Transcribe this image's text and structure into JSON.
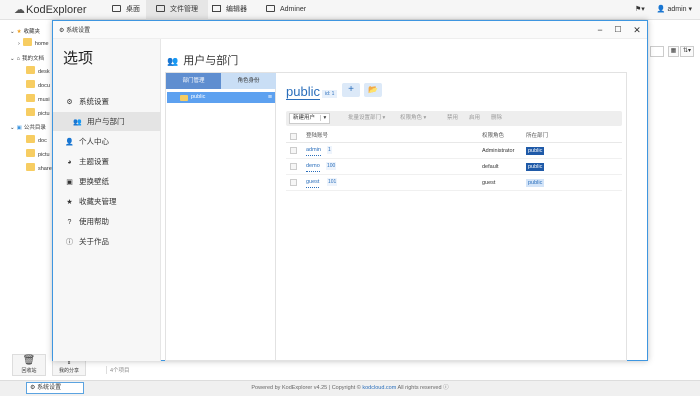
{
  "app": {
    "logo": "KodExplorer",
    "nav_tabs": [
      {
        "label": "桌面",
        "icon": "desktop-icon"
      },
      {
        "label": "文件管理",
        "icon": "folder-manage-icon"
      },
      {
        "label": "编辑器",
        "icon": "edit-icon"
      },
      {
        "label": "Adminer",
        "icon": "database-icon"
      }
    ],
    "user": "admin",
    "flag_icon": "flag-icon"
  },
  "background": {
    "tree": [
      {
        "label": "收藏夹",
        "kind": "star"
      },
      {
        "label": "home",
        "kind": "folder"
      },
      {
        "label": "我的文档",
        "kind": "home"
      },
      {
        "label": "desk",
        "kind": "folder"
      },
      {
        "label": "docu",
        "kind": "folder"
      },
      {
        "label": "musi",
        "kind": "folder"
      },
      {
        "label": "pictu",
        "kind": "folder"
      },
      {
        "label": "公共目录",
        "kind": "share"
      },
      {
        "label": "doc",
        "kind": "folder"
      },
      {
        "label": "pictu",
        "kind": "folder"
      },
      {
        "label": "share",
        "kind": "folder"
      }
    ],
    "bottom_icons": [
      {
        "label": "回收站",
        "icon": "trash-icon"
      },
      {
        "label": "我的分享",
        "icon": "share-icon"
      }
    ],
    "item_count": "4个项目",
    "footer": {
      "prefix": "Powered by KodExplorer v4.25 | Copyright ©",
      "link": "kodcloud.com",
      "suffix": "All rights reserved"
    },
    "settings_button": "系统设置"
  },
  "modal": {
    "title": "系统设置",
    "sidebar_heading": "选项",
    "menu": [
      {
        "label": "系统设置",
        "icon": "gear-icon",
        "active": false
      },
      {
        "label": "用户与部门",
        "icon": "users-icon",
        "active": true
      },
      {
        "label": "个人中心",
        "icon": "user-icon",
        "active": false
      },
      {
        "label": "主题设置",
        "icon": "palette-icon",
        "active": false
      },
      {
        "label": "更换壁纸",
        "icon": "image-icon",
        "active": false
      },
      {
        "label": "收藏夹管理",
        "icon": "star-icon",
        "active": false
      },
      {
        "label": "使用帮助",
        "icon": "question-icon",
        "active": false
      },
      {
        "label": "关于作品",
        "icon": "info-icon",
        "active": false
      }
    ],
    "heading": "用户与部门",
    "tabs": [
      "部门管理",
      "角色身份"
    ],
    "group": {
      "name": "public",
      "tag": "id: 1"
    },
    "toolbar": {
      "new_user": "新建用户",
      "batch_dept": "批量设置部门",
      "permission_role": "权限角色",
      "disable": "禁用",
      "enable": "启用",
      "delete": "删除"
    },
    "table": {
      "headers": [
        "登陆账号",
        "权限角色",
        "所在部门"
      ],
      "rows": [
        {
          "name": "admin",
          "id": "1",
          "role": "Administrator",
          "dept": "public",
          "dept_style": "solid"
        },
        {
          "name": "demo",
          "id": "100",
          "role": "default",
          "dept": "public",
          "dept_style": "solid"
        },
        {
          "name": "guest",
          "id": "101",
          "role": "guest",
          "dept": "public",
          "dept_style": "light"
        }
      ]
    }
  },
  "colors": {
    "accent": "#2a6ebb",
    "modal_border": "#3e96e0",
    "selected_group": "#5da1f0",
    "dept_badge": "#1f5aa8",
    "folder": "#f7cd62"
  }
}
